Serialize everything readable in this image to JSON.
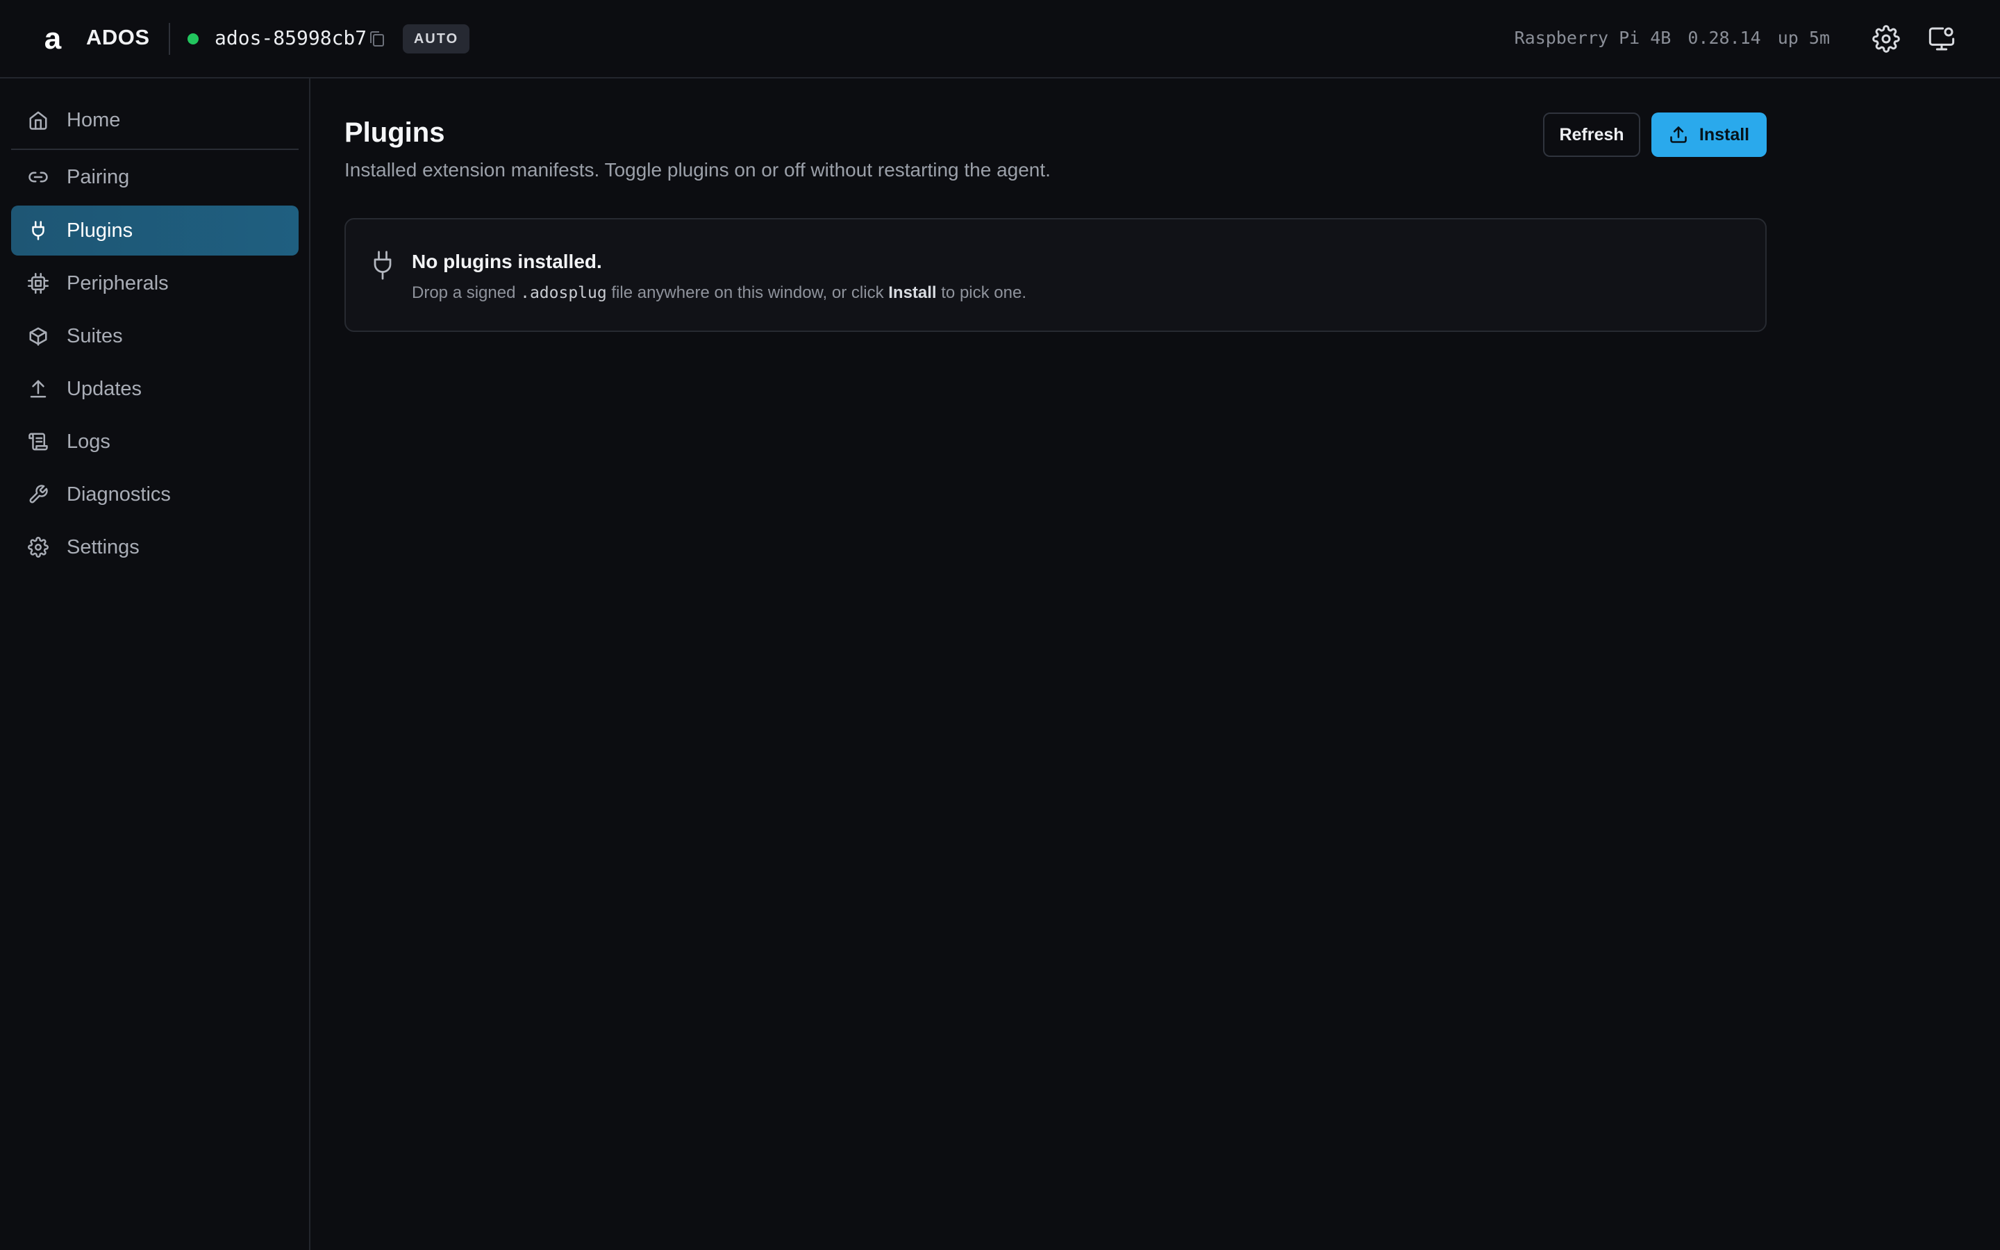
{
  "header": {
    "app_name": "ADOS",
    "device_id": "ados-85998cb7",
    "mode_badge": "AUTO",
    "status_color": "#22c55e",
    "sys_info": {
      "board": "Raspberry Pi 4B",
      "version": "0.28.14",
      "uptime": "up 5m"
    },
    "icons": [
      "copy-icon",
      "gear-icon",
      "display-icon"
    ]
  },
  "sidebar": {
    "items": [
      {
        "label": "Home",
        "icon": "home-icon",
        "active": false
      },
      {
        "label": "Pairing",
        "icon": "link-icon",
        "active": false
      },
      {
        "label": "Plugins",
        "icon": "plug-icon",
        "active": true
      },
      {
        "label": "Peripherals",
        "icon": "chip-icon",
        "active": false
      },
      {
        "label": "Suites",
        "icon": "package-icon",
        "active": false
      },
      {
        "label": "Updates",
        "icon": "upload-icon",
        "active": false
      },
      {
        "label": "Logs",
        "icon": "scroll-icon",
        "active": false
      },
      {
        "label": "Diagnostics",
        "icon": "wrench-icon",
        "active": false
      },
      {
        "label": "Settings",
        "icon": "gear-icon",
        "active": false
      }
    ]
  },
  "main": {
    "title": "Plugins",
    "subtitle": "Installed extension manifests. Toggle plugins on or off without restarting the agent.",
    "refresh_label": "Refresh",
    "install_label": "Install",
    "empty": {
      "title": "No plugins installed.",
      "desc_before": "Drop a signed ",
      "desc_ext": ".adosplug",
      "desc_middle": " file anywhere on this window, or click ",
      "desc_action": "Install",
      "desc_after": " to pick one."
    }
  },
  "colors": {
    "accent": "#2aa9ec",
    "active_nav": "#1f5f80",
    "background": "#0c0d11"
  }
}
